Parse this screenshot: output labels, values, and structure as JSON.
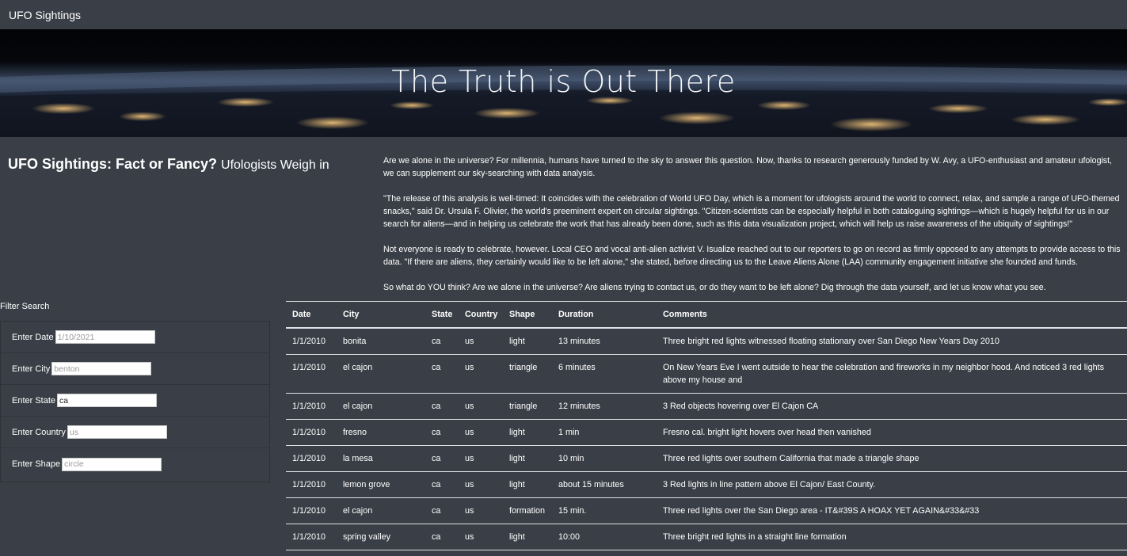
{
  "navbar": {
    "brand": "UFO Sightings"
  },
  "hero": {
    "title": "The Truth is Out There"
  },
  "intro": {
    "heading": "UFO Sightings: Fact or Fancy?",
    "subheading": "Ufologists Weigh in",
    "paragraphs": [
      "Are we alone in the universe? For millennia, humans have turned to the sky to answer this question. Now, thanks to research generously funded by W. Avy, a UFO-enthusiast and amateur ufologist, we can supplement our sky-searching with data analysis.",
      "\"The release of this analysis is well-timed: It coincides with the celebration of World UFO Day, which is a moment for ufologists around the world to connect, relax, and sample a range of UFO-themed snacks,\" said Dr. Ursula F. Olivier, the world's preeminent expert on circular sightings. \"Citizen-scientists can be especially helpful in both cataloguing sightings—which is hugely helpful for us in our search for aliens—and in helping us celebrate the work that has already been done, such as this data visualization project, which will help us raise awareness of the ubiquity of sightings!\"",
      "Not everyone is ready to celebrate, however. Local CEO and vocal anti-alien activist V. Isualize reached out to our reporters to go on record as firmly opposed to any attempts to provide access to this data. \"If there are aliens, they certainly would like to be left alone,\" she stated, before directing us to the Leave Aliens Alone (LAA) community engagement initiative she founded and funds.",
      "So what do YOU think? Are we alone in the universe? Are aliens trying to contact us, or do they want to be left alone? Dig through the data yourself, and let us know what you see."
    ]
  },
  "filters": {
    "title": "Filter Search",
    "items": [
      {
        "label": "Enter Date",
        "value": "",
        "placeholder": "1/10/2021"
      },
      {
        "label": "Enter City",
        "value": "",
        "placeholder": "benton"
      },
      {
        "label": "Enter State",
        "value": "ca",
        "placeholder": "ca"
      },
      {
        "label": "Enter Country",
        "value": "",
        "placeholder": "us"
      },
      {
        "label": "Enter Shape",
        "value": "",
        "placeholder": "circle"
      }
    ]
  },
  "table": {
    "headers": [
      "Date",
      "City",
      "State",
      "Country",
      "Shape",
      "Duration",
      "Comments"
    ],
    "rows": [
      [
        "1/1/2010",
        "bonita",
        "ca",
        "us",
        "light",
        "13 minutes",
        "Three bright red lights witnessed floating stationary over San Diego New Years Day 2010"
      ],
      [
        "1/1/2010",
        "el cajon",
        "ca",
        "us",
        "triangle",
        "6 minutes",
        "On New Years Eve I went outside to hear the celebration and fireworks in my neighbor hood. And noticed 3 red lights above my house and"
      ],
      [
        "1/1/2010",
        "el cajon",
        "ca",
        "us",
        "triangle",
        "12 minutes",
        "3 Red objects hovering over El Cajon CA"
      ],
      [
        "1/1/2010",
        "fresno",
        "ca",
        "us",
        "light",
        "1 min",
        "Fresno cal. bright light hovers over head then vanished"
      ],
      [
        "1/1/2010",
        "la mesa",
        "ca",
        "us",
        "light",
        "10 min",
        "Three red lights over southern California that made a triangle shape"
      ],
      [
        "1/1/2010",
        "lemon grove",
        "ca",
        "us",
        "light",
        "about 15 minutes",
        "3 Red lights in line pattern above El Cajon/ East County."
      ],
      [
        "1/1/2010",
        "el cajon",
        "ca",
        "us",
        "formation",
        "15 min.",
        "Three red lights over the San Diego area - IT&#39S A HOAX YET AGAIN&#33&#33"
      ],
      [
        "1/1/2010",
        "spring valley",
        "ca",
        "us",
        "light",
        "10:00",
        "Three bright red lights in a straight line formation"
      ]
    ]
  }
}
